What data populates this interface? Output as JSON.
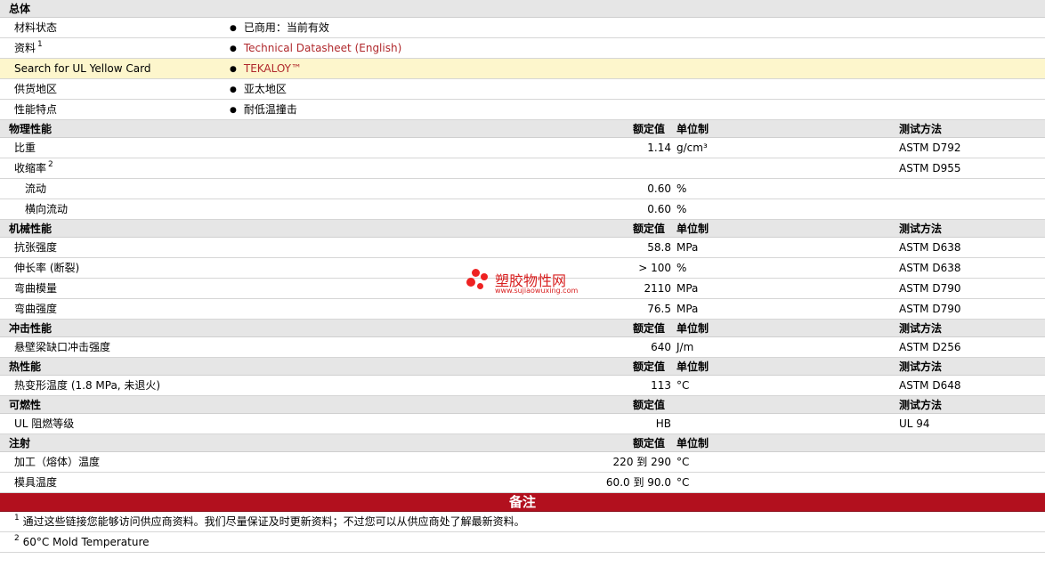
{
  "general": {
    "title": "总体",
    "rows": [
      {
        "label": "材料状态",
        "value": "已商用：当前有效"
      },
      {
        "label": "资料",
        "sup": "1",
        "value": "Technical Datasheet (English)"
      },
      {
        "label": "Search for UL Yellow Card",
        "value": "TEKALOY™"
      },
      {
        "label": "供货地区",
        "value": "亚太地区"
      },
      {
        "label": "性能特点",
        "value": "耐低温撞击"
      }
    ]
  },
  "physical": {
    "title": "物理性能",
    "rated": "额定值",
    "unit": "单位制",
    "method": "测试方法",
    "rows": [
      {
        "label": "比重",
        "value": "1.14",
        "unit": "g/cm³",
        "method": "ASTM D792"
      },
      {
        "label": "收缩率",
        "sup": "2",
        "value": "",
        "unit": "",
        "method": "ASTM D955"
      },
      {
        "label": "流动",
        "value": "0.60",
        "unit": "%",
        "method": ""
      },
      {
        "label": "横向流动",
        "value": "0.60",
        "unit": "%",
        "method": ""
      }
    ]
  },
  "mechanical": {
    "title": "机械性能",
    "rated": "额定值",
    "unit": "单位制",
    "method": "测试方法",
    "rows": [
      {
        "label": "抗张强度",
        "value": "58.8",
        "unit": "MPa",
        "method": "ASTM D638"
      },
      {
        "label": "伸长率 (断裂)",
        "value": "> 100",
        "unit": "%",
        "method": "ASTM D638"
      },
      {
        "label": "弯曲模量",
        "value": "2110",
        "unit": "MPa",
        "method": "ASTM D790"
      },
      {
        "label": "弯曲强度",
        "value": "76.5",
        "unit": "MPa",
        "method": "ASTM D790"
      }
    ]
  },
  "impact": {
    "title": "冲击性能",
    "rated": "额定值",
    "unit": "单位制",
    "method": "测试方法",
    "rows": [
      {
        "label": "悬壁梁缺口冲击强度",
        "value": "640",
        "unit": "J/m",
        "method": "ASTM D256"
      }
    ]
  },
  "thermal": {
    "title": "热性能",
    "rated": "额定值",
    "unit": "单位制",
    "method": "测试方法",
    "rows": [
      {
        "label": "热变形温度 (1.8 MPa, 未退火)",
        "value": "113",
        "unit": "°C",
        "method": "ASTM D648"
      }
    ]
  },
  "flammability": {
    "title": "可燃性",
    "rated": "额定值",
    "method": "测试方法",
    "rows": [
      {
        "label": "UL 阻燃等级",
        "value": "HB",
        "unit": "",
        "method": "UL 94"
      }
    ]
  },
  "injection": {
    "title": "注射",
    "rated": "额定值",
    "unit": "单位制",
    "rows": [
      {
        "label": "加工（熔体）温度",
        "value": "220 到  290",
        "unit": "°C",
        "method": ""
      },
      {
        "label": "模具温度",
        "value": "60.0 到  90.0",
        "unit": "°C",
        "method": ""
      }
    ]
  },
  "notes": {
    "title": "备注",
    "items": [
      {
        "num": "1",
        "text": "通过这些链接您能够访问供应商资料。我们尽量保证及时更新资料；不过您可以从供应商处了解最新资料。"
      },
      {
        "num": "2",
        "text": "60°C Mold Temperature"
      }
    ]
  },
  "watermark": {
    "name": "塑胶物性网",
    "url": "www.sujiaowuxing.com"
  },
  "colors": {
    "section_bg": "#e6e6e6",
    "highlight_bg": "#fdf6cc",
    "link": "#b0282c",
    "notes_bar": "#b2101e"
  }
}
